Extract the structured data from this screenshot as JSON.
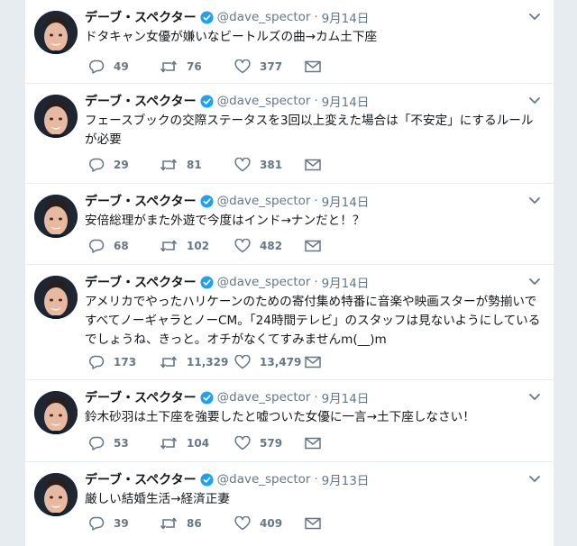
{
  "tweets": [
    {
      "name": "デーブ・スペクター",
      "handle": "@dave_spector",
      "separator": "·",
      "date": "9月14日",
      "text": "ドタキャン女優が嫌いなビートルズの曲→カム土下座",
      "replies": "49",
      "retweets": "76",
      "likes": "377"
    },
    {
      "name": "デーブ・スペクター",
      "handle": "@dave_spector",
      "separator": "·",
      "date": "9月14日",
      "text": "フェースブックの交際ステータスを3回以上変えた場合は「不安定」にするルールが必要",
      "replies": "29",
      "retweets": "81",
      "likes": "381"
    },
    {
      "name": "デーブ・スペクター",
      "handle": "@dave_spector",
      "separator": "·",
      "date": "9月14日",
      "text": "安倍総理がまた外遊で今度はインド→ナンだと！？",
      "replies": "68",
      "retweets": "102",
      "likes": "482"
    },
    {
      "name": "デーブ・スペクター",
      "handle": "@dave_spector",
      "separator": "·",
      "date": "9月14日",
      "text": "アメリカでやったハリケーンのための寄付集め特番に音楽や映画スターが勢揃いですべてノーギャラとノーCM。「24時間テレビ」のスタッフは見ないようにしているでしょうね、きっと。オチがなくてすみませんm(__)m",
      "replies": "173",
      "retweets": "11,329",
      "likes": "13,479"
    },
    {
      "name": "デーブ・スペクター",
      "handle": "@dave_spector",
      "separator": "·",
      "date": "9月14日",
      "text": "鈴木砂羽は土下座を強要したと嘘ついた女優に一言→土下座しなさい！",
      "replies": "53",
      "retweets": "104",
      "likes": "579"
    },
    {
      "name": "デーブ・スペクター",
      "handle": "@dave_spector",
      "separator": "·",
      "date": "9月13日",
      "text": "厳しい結婚生活→経済正妻",
      "replies": "39",
      "retweets": "86",
      "likes": "409"
    }
  ],
  "icons": {
    "verified": "verified-badge-icon",
    "caret": "chevron-down-icon",
    "reply": "reply-icon",
    "retweet": "retweet-icon",
    "like": "heart-icon",
    "dm": "envelope-icon"
  },
  "colors": {
    "background": "#e6ecf0",
    "card": "#ffffff",
    "text": "#14171a",
    "muted": "#657786",
    "verified": "#1da1f2"
  }
}
